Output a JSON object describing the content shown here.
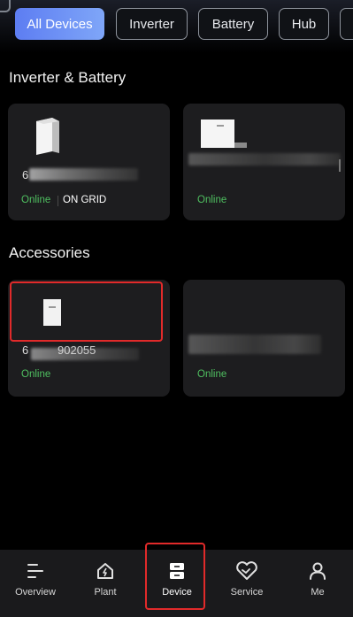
{
  "filters": [
    {
      "label": "All Devices",
      "active": true
    },
    {
      "label": "Inverter",
      "active": false
    },
    {
      "label": "Battery",
      "active": false
    },
    {
      "label": "Hub",
      "active": false
    }
  ],
  "sections": {
    "inverter_battery": {
      "title": "Inverter & Battery",
      "cards": [
        {
          "serial_prefix": "6",
          "status": "Online",
          "mode": "ON GRID"
        },
        {
          "status": "Online"
        }
      ]
    },
    "accessories": {
      "title": "Accessories",
      "cards": [
        {
          "serial_prefix": "6",
          "serial_partial": "902055",
          "status": "Online"
        },
        {
          "status": "Online"
        }
      ]
    }
  },
  "tabbar": {
    "items": [
      {
        "label": "Overview",
        "icon": "overview-icon"
      },
      {
        "label": "Plant",
        "icon": "plant-icon"
      },
      {
        "label": "Device",
        "icon": "device-icon",
        "active": true
      },
      {
        "label": "Service",
        "icon": "service-icon"
      },
      {
        "label": "Me",
        "icon": "me-icon"
      }
    ]
  },
  "colors": {
    "accent": "#6b8ff5",
    "online": "#4fbf60",
    "highlight": "#e12a2a",
    "card": "#1d1d1f"
  }
}
